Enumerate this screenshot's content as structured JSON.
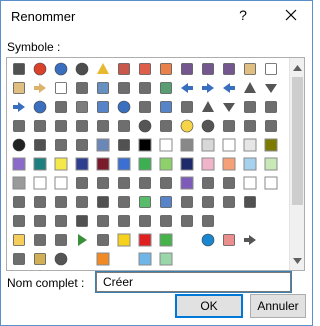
{
  "dialog": {
    "title": "Renommer",
    "help_label": "?",
    "symbol_label": "Symbole :",
    "name_label": "Nom complet :",
    "name_value": "Créer",
    "ok_label": "OK",
    "cancel_label": "Annuler"
  },
  "symbol_rows": [
    [
      {
        "n": "org-chart-icon",
        "c": "#333"
      },
      {
        "n": "error-icon",
        "c": "#d9412b"
      },
      {
        "n": "info-icon",
        "c": "#3a6fbf"
      },
      {
        "n": "target-icon",
        "c": "#4d4d4d"
      },
      {
        "n": "warning-icon",
        "c": "#e8b92f"
      },
      {
        "n": "exclamation-icon",
        "c": "#c0392b"
      },
      {
        "n": "flag-red-icon",
        "c": "#d9412b"
      },
      {
        "n": "shield-icon",
        "c": "#e86b2a"
      },
      {
        "n": "save-icon",
        "c": "#5a3a7a"
      },
      {
        "n": "save-as-icon",
        "c": "#5a3a7a"
      },
      {
        "n": "save-all-icon",
        "c": "#5a3a7a"
      },
      {
        "n": "folder-icon",
        "c": "#dcb36b"
      },
      {
        "n": "document-icon",
        "c": "#ffffff"
      }
    ],
    [
      {
        "n": "open-folder-icon",
        "c": "#dcb36b"
      },
      {
        "n": "folder-arrow-icon",
        "c": "#dcb36b"
      },
      {
        "n": "copy-icon",
        "c": "#ffffff"
      },
      {
        "n": "printer-icon",
        "c": "#555"
      },
      {
        "n": "picture-icon",
        "c": "#4c7bb5"
      },
      {
        "n": "camera-icon",
        "c": "#555"
      },
      {
        "n": "home-icon",
        "c": "#555"
      },
      {
        "n": "grid-table-icon",
        "c": "#3c8d5a"
      },
      {
        "n": "double-left-arrow-icon",
        "c": "#3a6fbf"
      },
      {
        "n": "double-right-arrow-icon",
        "c": "#3a6fbf"
      },
      {
        "n": "left-arrow-icon",
        "c": "#3a6fbf"
      },
      {
        "n": "up-arrow-icon",
        "c": "#555"
      },
      {
        "n": "down-arrow-icon",
        "c": "#555"
      }
    ],
    [
      {
        "n": "right-arrow-icon",
        "c": "#3a6fbf"
      },
      {
        "n": "back-circle-icon",
        "c": "#3a6fbf"
      },
      {
        "n": "pin-icon",
        "c": "#555"
      },
      {
        "n": "padlock-icon",
        "c": "#666"
      },
      {
        "n": "question-icon",
        "c": "#3a6fbf"
      },
      {
        "n": "help-circle-icon",
        "c": "#3a6fbf"
      },
      {
        "n": "grid-view-icon",
        "c": "#555"
      },
      {
        "n": "chart-window-icon",
        "c": "#3a6fbf"
      },
      {
        "n": "magnifier-icon",
        "c": "#555"
      },
      {
        "n": "filter-icon",
        "c": "#555"
      },
      {
        "n": "filter-dropdown-icon",
        "c": "#555"
      },
      {
        "n": "sort-icon",
        "c": "#555"
      },
      {
        "n": "scales-icon",
        "c": "#555"
      }
    ],
    [
      {
        "n": "chain-link-icon",
        "c": "#555"
      },
      {
        "n": "microphone-icon",
        "c": "#555"
      },
      {
        "n": "mute-icon",
        "c": "#555"
      },
      {
        "n": "user-remove-icon",
        "c": "#555"
      },
      {
        "n": "user-icon",
        "c": "#555"
      },
      {
        "n": "settings-gear-icon",
        "c": "#555"
      },
      {
        "n": "clock-icon",
        "c": "#555"
      },
      {
        "n": "hand-icon",
        "c": "#555"
      },
      {
        "n": "smiley-icon",
        "c": "#f5d547"
      },
      {
        "n": "sad-face-icon",
        "c": "#555"
      },
      {
        "n": "calculator-icon",
        "c": "#555"
      },
      {
        "n": "phone-icon",
        "c": "#555"
      },
      {
        "n": "piggy-bank-icon",
        "c": "#555"
      }
    ],
    [
      {
        "n": "eight-ball-icon",
        "c": "#222"
      },
      {
        "n": "dollar-quote-icon",
        "c": "#333"
      },
      {
        "n": "horizontal-line-icon",
        "c": "#555"
      },
      {
        "n": "copy-stack-icon",
        "c": "#555"
      },
      {
        "n": "swatch-blue-grey-icon",
        "c": "#6b87b8"
      },
      {
        "n": "half-shaded-icon",
        "c": "#333"
      },
      {
        "n": "swatch-black-icon",
        "c": "#000000"
      },
      {
        "n": "swatch-white-icon",
        "c": "#ffffff"
      },
      {
        "n": "swatch-grey-icon",
        "c": "#888888"
      },
      {
        "n": "swatch-light-grey-icon",
        "c": "#d8d8d8"
      },
      {
        "n": "swatch-white-2-icon",
        "c": "#ffffff"
      },
      {
        "n": "swatch-lightgrey-2-icon",
        "c": "#e6e6e6"
      },
      {
        "n": "swatch-olive-icon",
        "c": "#7d7a00"
      }
    ],
    [
      {
        "n": "swatch-purple-icon",
        "c": "#8a6bc9"
      },
      {
        "n": "swatch-teal-icon",
        "c": "#1e7f7f"
      },
      {
        "n": "swatch-yellow-icon",
        "c": "#f5e84b"
      },
      {
        "n": "swatch-dark-blue-icon",
        "c": "#2e3f8f"
      },
      {
        "n": "swatch-maroon-icon",
        "c": "#7a1a2a"
      },
      {
        "n": "swatch-blue-icon",
        "c": "#3b6fd1"
      },
      {
        "n": "swatch-green-icon",
        "c": "#3cb050"
      },
      {
        "n": "swatch-lime-icon",
        "c": "#8ed16b"
      },
      {
        "n": "swatch-navy-icon",
        "c": "#1f2a6b"
      },
      {
        "n": "swatch-pink-icon",
        "c": "#f0b5c8"
      },
      {
        "n": "swatch-salmon-icon",
        "c": "#f5a077"
      },
      {
        "n": "swatch-light-blue-icon",
        "c": "#a6d2f0"
      },
      {
        "n": "swatch-pale-green-icon",
        "c": "#c9e8b8"
      }
    ],
    [
      {
        "n": "swatch-grey-2-icon",
        "c": "#9a9a9a"
      },
      {
        "n": "swatch-white-3-icon",
        "c": "#ffffff"
      },
      {
        "n": "swatch-white-4-icon",
        "c": "#ffffff"
      },
      {
        "n": "grid-pattern-icon",
        "c": "#555"
      },
      {
        "n": "hatched-icon",
        "c": "#555"
      },
      {
        "n": "web-icon",
        "c": "#555"
      },
      {
        "n": "cube-icon",
        "c": "#555"
      },
      {
        "n": "books-icon",
        "c": "#555"
      },
      {
        "n": "swatch-violet-icon",
        "c": "#7e5bb8"
      },
      {
        "n": "diagonal-swatch-icon",
        "c": "#555"
      },
      {
        "n": "stripe-swatch-icon",
        "c": "#555"
      },
      {
        "n": "swatch-white-5-icon",
        "c": "#ffffff"
      },
      {
        "n": "swatch-white-6-icon",
        "c": "#ffffff"
      }
    ],
    [
      {
        "n": "square-outline-icon",
        "c": "#555"
      },
      {
        "n": "dotted-square-icon",
        "c": "#555"
      },
      {
        "n": "columns-icon",
        "c": "#555"
      },
      {
        "n": "lines-icon",
        "c": "#555"
      },
      {
        "n": "text-a-icon",
        "c": "#333"
      },
      {
        "n": "cross-icon",
        "c": "#555"
      },
      {
        "n": "checkmark-icon",
        "c": "#3cb050"
      },
      {
        "n": "refresh-icon",
        "c": "#3a6fbf"
      },
      {
        "n": "dashes-icon",
        "c": "#555"
      },
      {
        "n": "table-icon",
        "c": "#555"
      },
      {
        "n": "rows-icon",
        "c": "#555"
      },
      {
        "n": "pi-icon",
        "c": "#333"
      },
      {
        "n": "blank-1-icon",
        "c": "#ffffff"
      }
    ],
    [
      {
        "n": "layout-icon",
        "c": "#555"
      },
      {
        "n": "view-icon",
        "c": "#555"
      },
      {
        "n": "form-icon",
        "c": "#555"
      },
      {
        "n": "text-box-a-icon",
        "c": "#333"
      },
      {
        "n": "edit-icon",
        "c": "#555"
      },
      {
        "n": "list-icon",
        "c": "#555"
      },
      {
        "n": "frame-icon",
        "c": "#555"
      },
      {
        "n": "outline-icon",
        "c": "#555"
      },
      {
        "n": "connector-icon",
        "c": "#555"
      },
      {
        "n": "code-brackets-icon",
        "c": "#555"
      },
      {
        "n": "blank-2-icon",
        "c": "#ffffff"
      },
      {
        "n": "blank-3-icon",
        "c": "#ffffff"
      },
      {
        "n": "blank-4-icon",
        "c": "#ffffff"
      }
    ],
    [
      {
        "n": "pen-highlighter-icon",
        "c": "#f5c542"
      },
      {
        "n": "bell-icon",
        "c": "#555"
      },
      {
        "n": "brush-icon",
        "c": "#555"
      },
      {
        "n": "play-icon",
        "c": "#3a8f3a"
      },
      {
        "n": "anchor-icon",
        "c": "#555"
      },
      {
        "n": "swatch-yellow-2-icon",
        "c": "#f7d21a"
      },
      {
        "n": "swatch-red-icon",
        "c": "#e02020"
      },
      {
        "n": "swatch-green-2-icon",
        "c": "#45b34a"
      },
      {
        "n": "blank-5-icon",
        "c": "#ffffff"
      },
      {
        "n": "internet-explorer-icon",
        "c": "#1a86d0"
      },
      {
        "n": "ruler-icon",
        "c": "#e87a7a"
      },
      {
        "n": "arrow-shape-icon",
        "c": "#555"
      },
      {
        "n": "blank-6-icon",
        "c": "#ffffff"
      }
    ],
    [
      {
        "n": "badge-icon",
        "c": "#555"
      },
      {
        "n": "key-icon",
        "c": "#c9a13a"
      },
      {
        "n": "gauge-icon",
        "c": "#555"
      },
      {
        "n": "blank-7-icon",
        "c": "#ffffff"
      },
      {
        "n": "swatch-orange-icon",
        "c": "#f08a24"
      },
      {
        "n": "blank-8-icon",
        "c": "#ffffff"
      },
      {
        "n": "swatch-lightblue-2-icon",
        "c": "#6fb5e8"
      },
      {
        "n": "swatch-mint-icon",
        "c": "#9bd6a8"
      },
      {
        "n": "blank-9-icon",
        "c": "#ffffff"
      },
      {
        "n": "blank-10-icon",
        "c": "#ffffff"
      },
      {
        "n": "blank-11-icon",
        "c": "#ffffff"
      },
      {
        "n": "blank-12-icon",
        "c": "#ffffff"
      },
      {
        "n": "blank-13-icon",
        "c": "#ffffff"
      }
    ]
  ]
}
